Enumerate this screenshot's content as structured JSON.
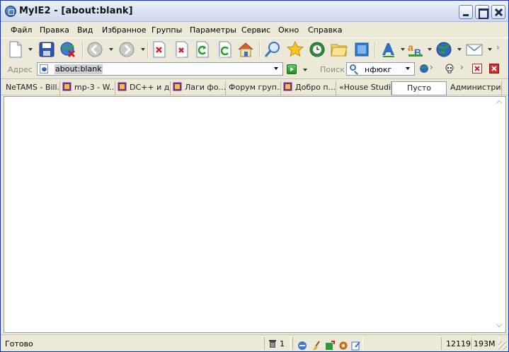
{
  "window": {
    "title": "MyIE2 - [about:blank]"
  },
  "menu": [
    "Файл",
    "Правка",
    "Вид",
    "Избранное",
    "Группы",
    "Параметры",
    "Сервис",
    "Окно",
    "Справка"
  ],
  "address": {
    "label": "Адрес",
    "value": "about:blank"
  },
  "search": {
    "label": "Поиск",
    "value": "нфюкг"
  },
  "tabs": [
    {
      "label": "NeTAMS - Bill..."
    },
    {
      "label": "mp-3 - W..."
    },
    {
      "label": "DC++ и д..."
    },
    {
      "label": "Лаги фо..."
    },
    {
      "label": "Форум груп..."
    },
    {
      "label": "Добро п..."
    },
    {
      "label": "«House Studi..."
    },
    {
      "label": "Пусто"
    },
    {
      "label": "Администри..."
    }
  ],
  "status": {
    "text": "Готово",
    "trash_count": "1",
    "counter": "12119",
    "memory": "193M"
  },
  "colors": {
    "window_face": "#ece9d8",
    "frame_border": "#0831d9",
    "input_border": "#7f9db9",
    "address_selection": "#cfcfcf"
  }
}
